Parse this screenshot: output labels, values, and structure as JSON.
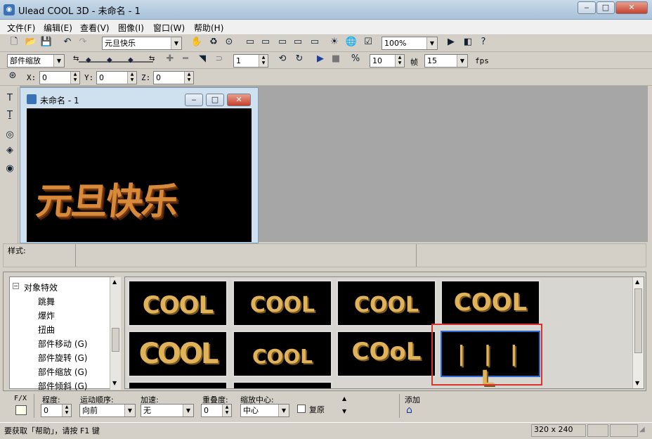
{
  "window": {
    "title": "Ulead COOL 3D - 未命名 - 1"
  },
  "menu": [
    "文件(F)",
    "编辑(E)",
    "查看(V)",
    "图像(I)",
    "窗口(W)",
    "帮助(H)"
  ],
  "toolbar1": {
    "text_select": "元旦快乐",
    "zoom_select": "100%"
  },
  "toolbar2": {
    "part_select": "部件缩放",
    "frame_value": "1",
    "frames_value": "10",
    "frame_label": "帧",
    "fps_value": "15",
    "fps_label": "fps"
  },
  "toolbar3": {
    "x_label": "X:",
    "x_value": "0",
    "y_label": "Y:",
    "y_value": "0",
    "z_label": "Z:",
    "z_value": "0"
  },
  "document": {
    "title": "未命名 - 1",
    "canvas_text": "元旦快乐"
  },
  "style_bar": {
    "label": "样式:"
  },
  "tree": {
    "root": "对象特效",
    "items": [
      "跳舞",
      "爆炸",
      "扭曲",
      "部件移动 (G)",
      "部件旋转 (G)",
      "部件缩放 (G)",
      "部件倾斜 (G)"
    ]
  },
  "thumbnails": [
    {
      "text": "COOL"
    },
    {
      "text": "COOL"
    },
    {
      "text": "COOL"
    },
    {
      "text": "COOL"
    },
    {
      "text": "COOL"
    },
    {
      "text": "COOL"
    },
    {
      "text": "COoL"
    },
    {
      "text": "| | | L",
      "selected": true
    }
  ],
  "fx": {
    "fx_label": "F/X",
    "degree_label": "程度:",
    "degree_value": "0",
    "order_label": "运动顺序:",
    "order_value": "向前",
    "accel_label": "加速:",
    "accel_value": "无",
    "overlap_label": "重叠度:",
    "overlap_value": "0",
    "center_label": "缩放中心:",
    "center_value": "中心",
    "restore_label": "复原",
    "add_label": "添加"
  },
  "status": {
    "help_text": "要获取「帮助」，请按 F1 键",
    "size": "320 x 240"
  },
  "colors": {
    "highlight": "#d9342b",
    "canvas_bg": "#000000",
    "text_3d": "#d88a3a"
  }
}
